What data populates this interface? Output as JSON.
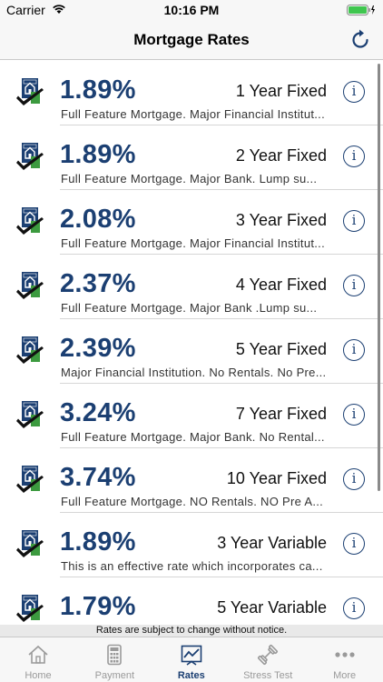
{
  "status_bar": {
    "carrier": "Carrier",
    "time": "10:16 PM"
  },
  "nav": {
    "title": "Mortgage Rates",
    "refresh_icon": "refresh-icon"
  },
  "rates": [
    {
      "rate": "1.89%",
      "term": "1 Year Fixed",
      "description": "Full Feature Mortgage. Major Financial Institut..."
    },
    {
      "rate": "1.89%",
      "term": "2 Year Fixed",
      "description": "Full Feature Mortgage. Major Bank. Lump su..."
    },
    {
      "rate": "2.08%",
      "term": "3 Year Fixed",
      "description": "Full Feature Mortgage. Major Financial Institut..."
    },
    {
      "rate": "2.37%",
      "term": "4 Year Fixed",
      "description": "Full Feature Mortgage. Major Bank .Lump su..."
    },
    {
      "rate": "2.39%",
      "term": "5 Year Fixed",
      "description": "Major Financial Institution. No Rentals. No Pre..."
    },
    {
      "rate": "3.24%",
      "term": "7 Year Fixed",
      "description": "Full Feature Mortgage. Major Bank. No Rental..."
    },
    {
      "rate": "3.74%",
      "term": "10 Year Fixed",
      "description": "Full Feature Mortgage. NO Rentals. NO Pre A..."
    },
    {
      "rate": "1.89%",
      "term": "3 Year Variable",
      "description": "This is an effective rate which incorporates ca..."
    },
    {
      "rate": "1.79%",
      "term": "5 Year Variable",
      "description": ""
    }
  ],
  "notice": "Rates are subject to change without notice.",
  "tabs": [
    {
      "label": "Home",
      "icon": "home-icon"
    },
    {
      "label": "Payment",
      "icon": "calculator-icon"
    },
    {
      "label": "Rates",
      "icon": "chart-icon",
      "active": true
    },
    {
      "label": "Stress Test",
      "icon": "dumbbell-icon"
    },
    {
      "label": "More",
      "icon": "more-icon"
    }
  ],
  "colors": {
    "accent": "#1b3f72",
    "logo_green": "#3c9a3f",
    "inactive_tab": "#9a9a9a"
  }
}
